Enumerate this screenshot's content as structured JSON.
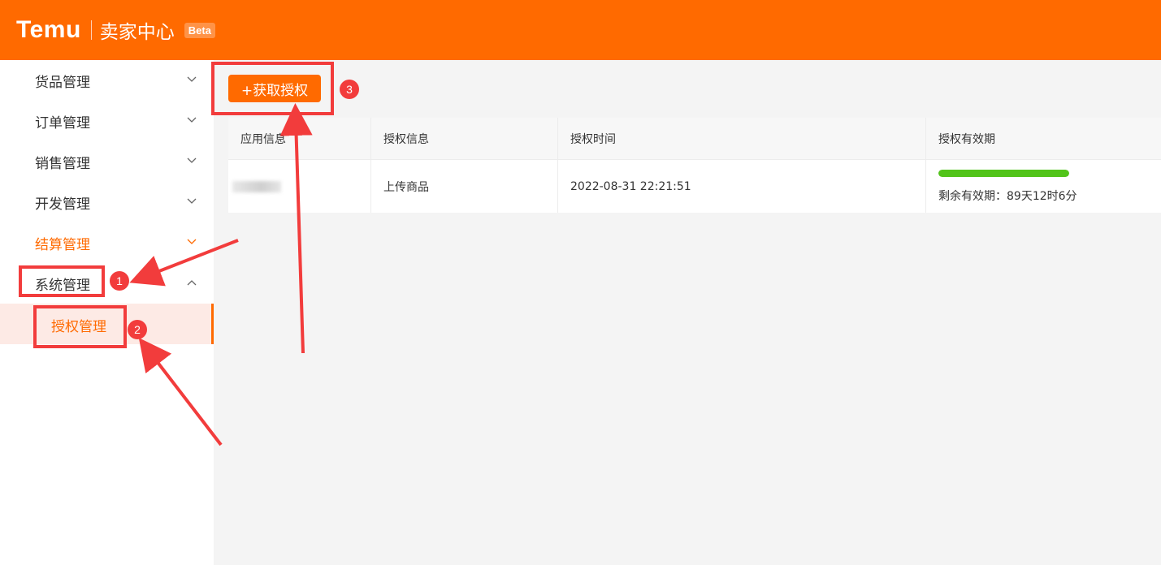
{
  "header": {
    "logo": "Temu",
    "title": "卖家中心",
    "beta": "Beta",
    "bg_color": "#ff6a00"
  },
  "sidebar": {
    "items": [
      {
        "label": "货品管理",
        "expanded": false
      },
      {
        "label": "订单管理",
        "expanded": false
      },
      {
        "label": "销售管理",
        "expanded": false
      },
      {
        "label": "开发管理",
        "expanded": false
      },
      {
        "label": "结算管理",
        "expanded": false,
        "highlighted": true
      },
      {
        "label": "系统管理",
        "expanded": true
      }
    ],
    "sub_item": {
      "label": "授权管理",
      "active": true
    }
  },
  "main": {
    "get_auth_button": "+获取授权",
    "table": {
      "headers": [
        "应用信息",
        "授权信息",
        "授权时间",
        "授权有效期"
      ],
      "rows": [
        {
          "app_info": "",
          "auth_info": "上传商品",
          "auth_time": "2022-08-31 22:21:51",
          "validity_progress": 1.0,
          "remaining": "剩余有效期：89天12时6分"
        }
      ]
    }
  },
  "annotations": {
    "badges": [
      "1",
      "2",
      "3"
    ],
    "color": "#f23c3c"
  },
  "accent_color": "#ff6a00",
  "progress_color": "#52c41a"
}
